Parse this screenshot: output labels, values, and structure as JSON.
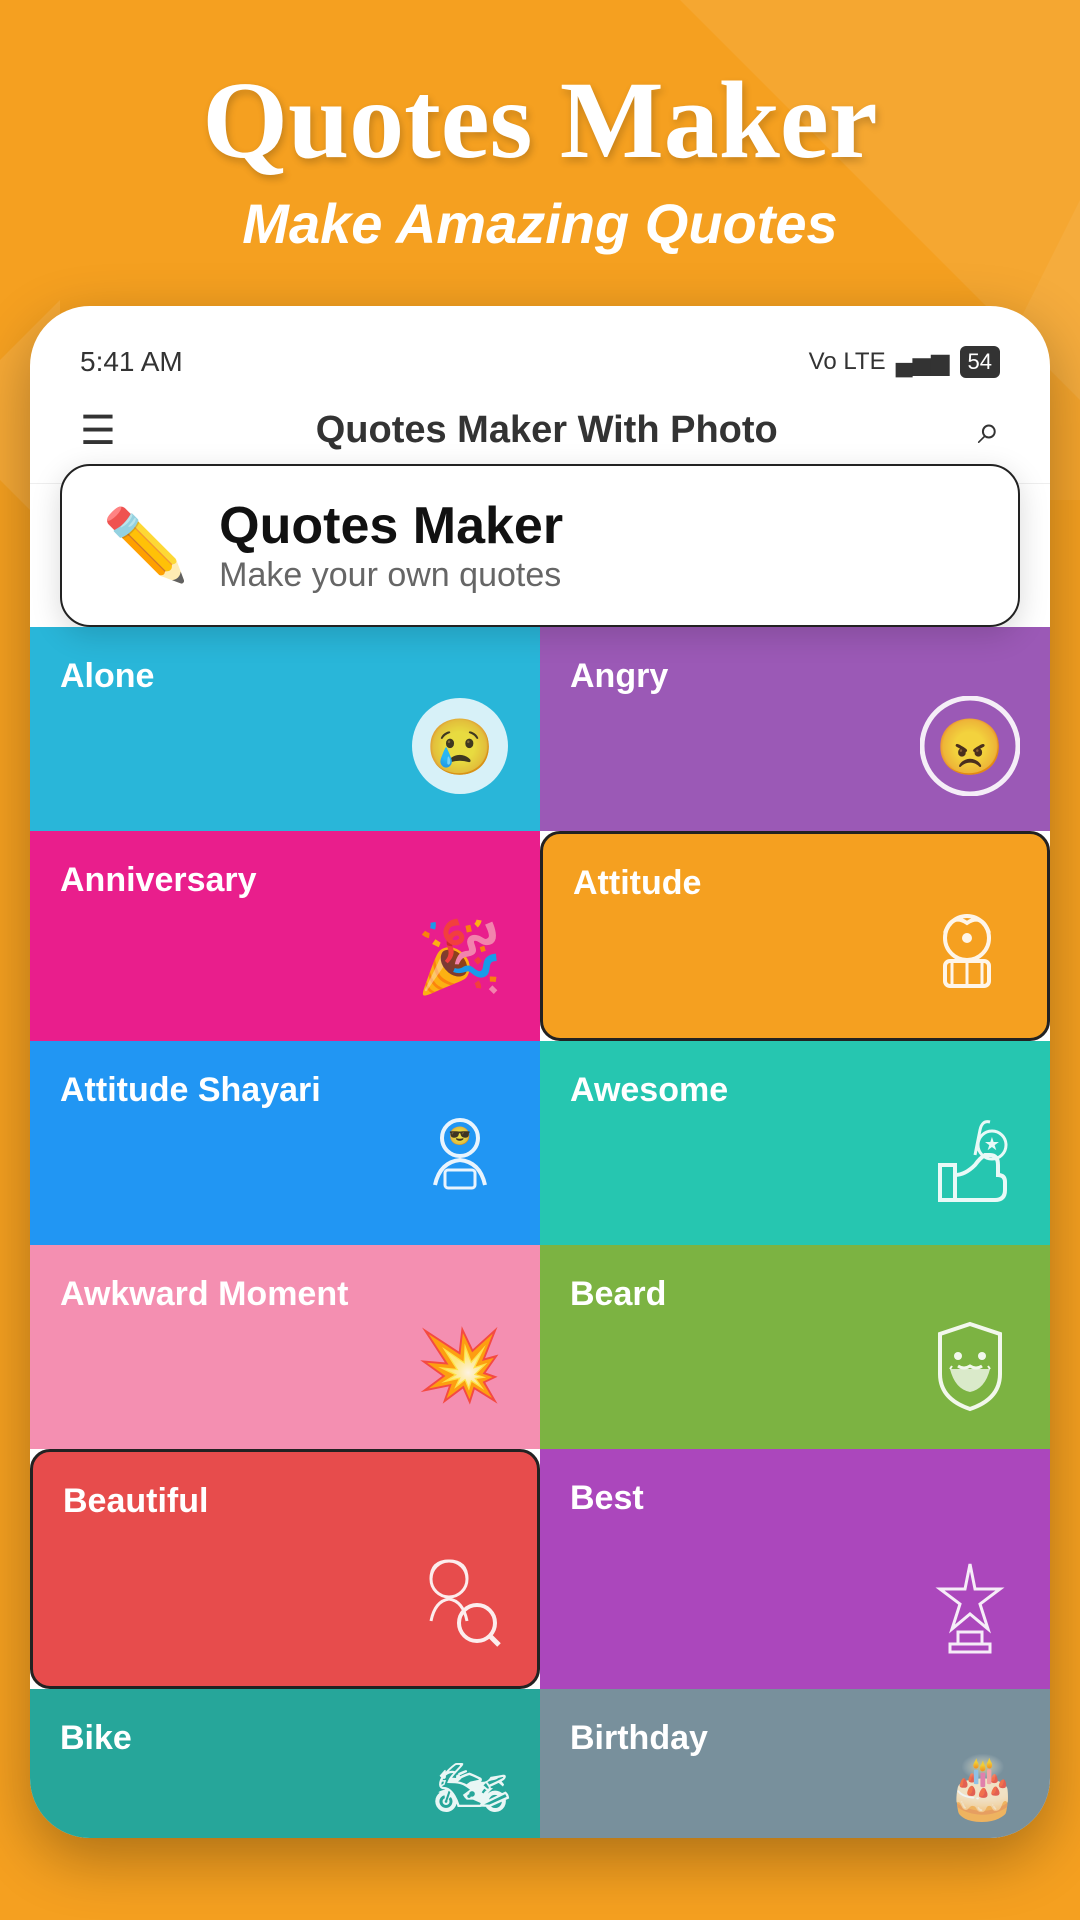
{
  "app": {
    "title": "Quotes Maker",
    "subtitle": "Make Amazing Quotes",
    "status_time": "5:41 AM",
    "status_signal": "▄▅▆",
    "status_battery": "54",
    "bar_title": "Quotes Maker With Photo"
  },
  "featured": {
    "title": "Quotes Maker",
    "subtitle": "Make your own quotes"
  },
  "categories": [
    {
      "id": "alone",
      "label": "Alone",
      "color": "#29B6D9",
      "icon": "😢"
    },
    {
      "id": "angry",
      "label": "Angry",
      "color": "#9B59B6",
      "icon": "😠"
    },
    {
      "id": "anniversary",
      "label": "Anniversary",
      "color": "#E91E8C",
      "icon": "🎉"
    },
    {
      "id": "attitude",
      "label": "Attitude",
      "color": "#F5A020",
      "icon": "👑"
    },
    {
      "id": "attitude-shayari",
      "label": "Attitude Shayari",
      "color": "#2196F3",
      "icon": "🤴"
    },
    {
      "id": "awesome",
      "label": "Awesome",
      "color": "#26C6B0",
      "icon": "👍"
    },
    {
      "id": "awkward",
      "label": "Awkward Moment",
      "color": "#F48FB1",
      "icon": "💥"
    },
    {
      "id": "beard",
      "label": "Beard",
      "color": "#7CB342",
      "icon": "🧔"
    },
    {
      "id": "beautiful",
      "label": "Beautiful",
      "color": "#E74C4C",
      "icon": "🌸"
    },
    {
      "id": "best",
      "label": "Best",
      "color": "#AB47BC",
      "icon": "⭐"
    },
    {
      "id": "bike",
      "label": "Bike",
      "color": "#26A69A",
      "icon": "🏍"
    },
    {
      "id": "birthday",
      "label": "Birthday",
      "color": "#78909C",
      "icon": "🎂"
    }
  ]
}
